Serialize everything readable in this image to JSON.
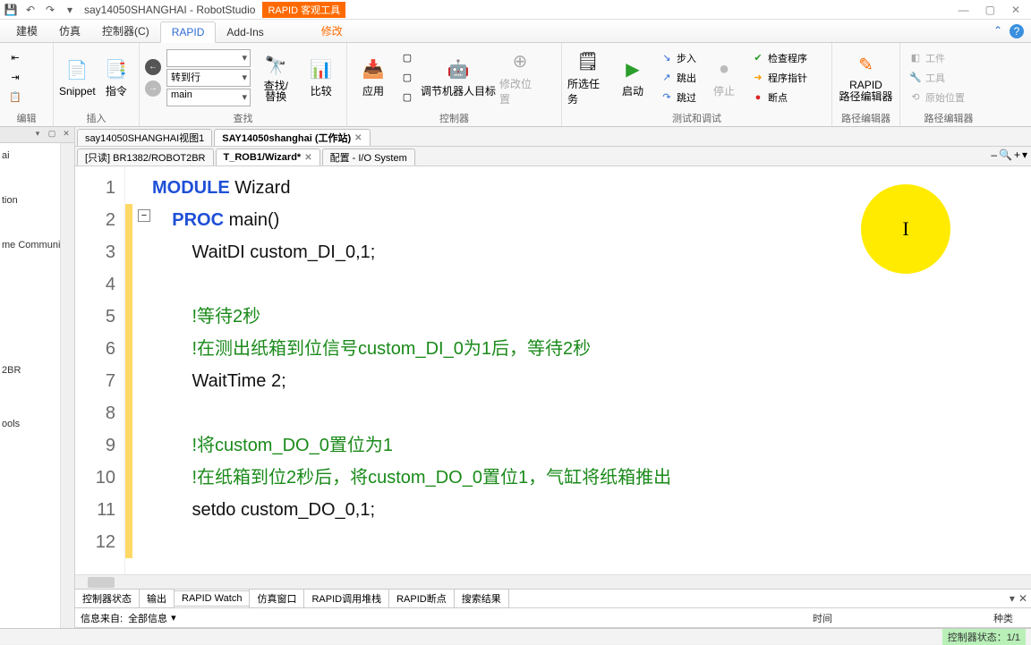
{
  "titlebar": {
    "title": "say14050SHANGHAI - RobotStudio",
    "context_tab": "RAPID 客观工具"
  },
  "ribbon_tabs": {
    "t0": "建模",
    "t1": "仿真",
    "t2": "控制器(C)",
    "t3": "RAPID",
    "t4": "Add-Ins",
    "t5": "修改"
  },
  "groups": {
    "edit": "编辑",
    "insert": "插入",
    "find": "查找",
    "controller": "控制器",
    "test": "测试和调试",
    "patheditor": "路径编辑器",
    "patheditor2": "路径编辑器"
  },
  "buttons": {
    "snippet": "Snippet",
    "instr": "指令",
    "find_replace": "查找/\n替换",
    "goto": "转到行",
    "main_combo": "main",
    "compare": "比较",
    "apply": "应用",
    "adjust_target": "调节机器人目标",
    "modify_pos": "修改位置",
    "sel_task": "所选任务",
    "start": "启动",
    "step_in": "步入",
    "step_out": "跳出",
    "step_over": "跳过",
    "stop": "停止",
    "check_prog": "检查程序",
    "prog_ptr": "程序指针",
    "breakpoint": "断点",
    "rapid": "RAPID\n路径编辑器",
    "workpiece": "工件",
    "tool": "工具",
    "orig_pos": "原始位置"
  },
  "doc_tabs": {
    "view1": "say14050SHANGHAI视图1",
    "station": "SAY14050shanghai (工作站)"
  },
  "sub_tabs": {
    "readonly": "[只读] BR1382/ROBOT2BR",
    "wizard": "T_ROB1/Wizard*",
    "config": "配置 - I/O System"
  },
  "left_tree": {
    "i0": "ai",
    "i1": "tion",
    "i2": "me Communica",
    "i3": "2BR",
    "i4": "ools"
  },
  "code": {
    "l1a": "MODULE",
    "l1b": " Wizard",
    "l2a": "PROC",
    "l2b": " main()",
    "l3a": "WaitDI",
    "l3b": " custom_DI_0,1;",
    "l5": "!等待2秒",
    "l6": "!在测出纸箱到位信号custom_DI_0为1后，等待2秒",
    "l7a": "WaitTime",
    "l7b": " 2;",
    "l9": "!将custom_DO_0置位为1",
    "l10": "!在纸箱到位2秒后，将custom_DO_0置位1，气缸将纸箱推出",
    "l11a": "setdo",
    "l11b": " custom_DO_0,1;"
  },
  "line_numbers": [
    "1",
    "2",
    "3",
    "4",
    "5",
    "6",
    "7",
    "8",
    "9",
    "10",
    "11",
    "12"
  ],
  "bottom_tabs": {
    "t0": "控制器状态",
    "t1": "输出",
    "t2": "RAPID Watch",
    "t3": "仿真窗口",
    "t4": "RAPID调用堆栈",
    "t5": "RAPID断点",
    "t6": "搜索结果"
  },
  "infobar": {
    "label": "信息来自:",
    "src": "全部信息",
    "col_time": "时间",
    "col_kind": "种类"
  },
  "status": "控制器状态：1/1"
}
